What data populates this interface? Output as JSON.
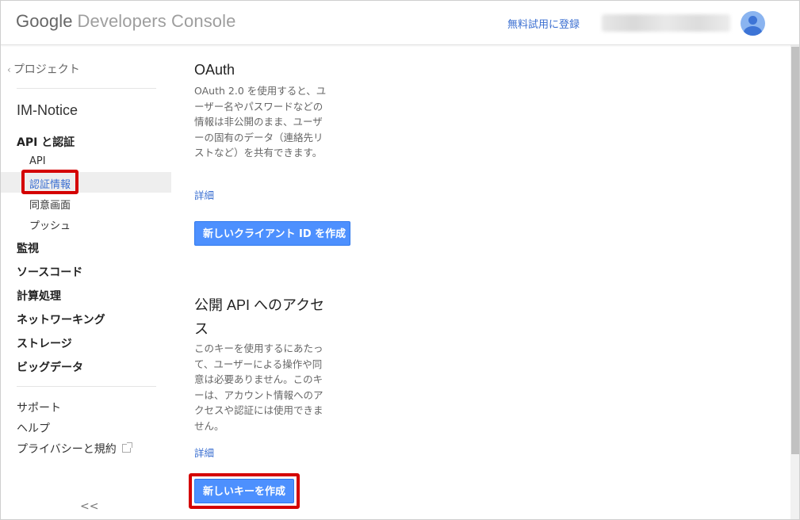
{
  "header": {
    "brand_google": "Google",
    "brand_product": "Developers Console",
    "trial_link": "無料試用に登録"
  },
  "sidebar": {
    "back_link": "プロジェクト",
    "project_name": "IM-Notice",
    "sections": [
      {
        "label": "API と認証"
      },
      {
        "label": "監視"
      },
      {
        "label": "ソースコード"
      },
      {
        "label": "計算処理"
      },
      {
        "label": "ネットワーキング"
      },
      {
        "label": "ストレージ"
      },
      {
        "label": "ビッグデータ"
      }
    ],
    "api_sub_items": [
      {
        "label": "API"
      },
      {
        "label": "認証情報"
      },
      {
        "label": "同意画面"
      },
      {
        "label": "プッシュ"
      }
    ],
    "footer_links": [
      {
        "label": "サポート"
      },
      {
        "label": "ヘルプ"
      },
      {
        "label": "プライバシーと規約"
      }
    ],
    "collapse_label": "<<"
  },
  "main": {
    "oauth": {
      "title": "OAuth",
      "description": "OAuth 2.0 を使用すると、ユーザー名やパスワードなどの情報は非公開のまま、ユーザーの固有のデータ（連絡先リストなど）を共有できます。",
      "more_link": "詳細",
      "button": "新しいクライアント ID を作成"
    },
    "public_api": {
      "title": "公開 API へのアクセス",
      "description": "このキーを使用するにあたって、ユーザーによる操作や同意は必要ありません。このキーは、アカウント情報へのアクセスや認証には使用できません。",
      "more_link": "詳細",
      "button": "新しいキーを作成"
    }
  },
  "colors": {
    "link": "#3b6fd1",
    "button": "#4d90fe",
    "annotation": "#d40000"
  }
}
